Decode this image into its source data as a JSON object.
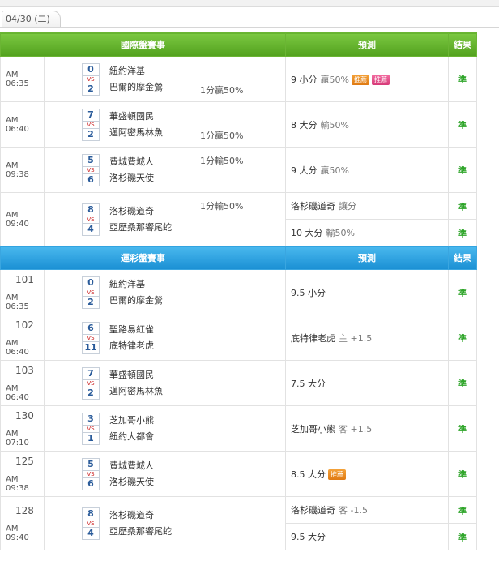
{
  "tab": {
    "label": "04/30 (二)"
  },
  "section1": {
    "headers": {
      "match": "國際盤賽事",
      "prediction": "預測",
      "result": "結果"
    },
    "rows": [
      {
        "time": "AM 06:35",
        "score_top": "0",
        "score_bottom": "2",
        "team_top": "紐約洋基",
        "team_bottom": "巴爾的摩金鶯",
        "hc": "1分贏50%",
        "hc_pos": "bottom",
        "preds": [
          {
            "main": "9 小分",
            "sub": "贏50%",
            "badges": [
              {
                "text": "推薦",
                "color": "orange"
              },
              {
                "text": "推薦",
                "color": "pink"
              }
            ],
            "result": "準"
          }
        ]
      },
      {
        "time": "AM 06:40",
        "score_top": "7",
        "score_bottom": "2",
        "team_top": "華盛頓國民",
        "team_bottom": "邁阿密馬林魚",
        "hc": "1分贏50%",
        "hc_pos": "bottom",
        "preds": [
          {
            "main": "8 大分",
            "sub": "輸50%",
            "badges": [],
            "result": "準"
          }
        ]
      },
      {
        "time": "AM 09:38",
        "score_top": "5",
        "score_bottom": "6",
        "team_top": "費城費城人",
        "team_bottom": "洛杉磯天使",
        "hc": "1分輸50%",
        "hc_pos": "top",
        "preds": [
          {
            "main": "9 大分",
            "sub": "贏50%",
            "badges": [],
            "result": "準"
          }
        ]
      },
      {
        "time": "AM 09:40",
        "score_top": "8",
        "score_bottom": "4",
        "team_top": "洛杉磯道奇",
        "team_bottom": "亞歷桑那響尾蛇",
        "hc": "1分輸50%",
        "hc_pos": "top",
        "preds": [
          {
            "main": "洛杉磯道奇",
            "sub": "讓分",
            "badges": [],
            "result": "準"
          },
          {
            "main": "10 大分",
            "sub": "輸50%",
            "badges": [],
            "result": "準"
          }
        ]
      }
    ]
  },
  "section2": {
    "headers": {
      "match": "運彩盤賽事",
      "prediction": "預測",
      "result": "結果"
    },
    "rows": [
      {
        "num": "101",
        "time": "AM 06:35",
        "score_top": "0",
        "score_bottom": "2",
        "team_top": "紐約洋基",
        "team_bottom": "巴爾的摩金鶯",
        "preds": [
          {
            "main": "9.5 小分",
            "sub": "",
            "badges": [],
            "result": "準"
          }
        ]
      },
      {
        "num": "102",
        "time": "AM 06:40",
        "score_top": "6",
        "score_bottom": "11",
        "team_top": "聖路易紅雀",
        "team_bottom": "底特律老虎",
        "preds": [
          {
            "main": "底特律老虎",
            "sub": "主 +1.5",
            "badges": [],
            "result": "準"
          }
        ]
      },
      {
        "num": "103",
        "time": "AM 06:40",
        "score_top": "7",
        "score_bottom": "2",
        "team_top": "華盛頓國民",
        "team_bottom": "邁阿密馬林魚",
        "preds": [
          {
            "main": "7.5 大分",
            "sub": "",
            "badges": [],
            "result": "準"
          }
        ]
      },
      {
        "num": "130",
        "time": "AM 07:10",
        "score_top": "3",
        "score_bottom": "1",
        "team_top": "芝加哥小熊",
        "team_bottom": "紐約大都會",
        "preds": [
          {
            "main": "芝加哥小熊",
            "sub": "客 +1.5",
            "badges": [],
            "result": "準"
          }
        ]
      },
      {
        "num": "125",
        "time": "AM 09:38",
        "score_top": "5",
        "score_bottom": "6",
        "team_top": "費城費城人",
        "team_bottom": "洛杉磯天使",
        "preds": [
          {
            "main": "8.5 大分",
            "sub": "",
            "badges": [
              {
                "text": "推薦",
                "color": "orange"
              }
            ],
            "result": "準"
          }
        ]
      },
      {
        "num": "128",
        "time": "AM 09:40",
        "score_top": "8",
        "score_bottom": "4",
        "team_top": "洛杉磯道奇",
        "team_bottom": "亞歷桑那響尾蛇",
        "preds": [
          {
            "main": "洛杉磯道奇",
            "sub": "客 -1.5",
            "badges": [],
            "result": "準"
          },
          {
            "main": "9.5 大分",
            "sub": "",
            "badges": [],
            "result": "準"
          }
        ]
      }
    ]
  }
}
